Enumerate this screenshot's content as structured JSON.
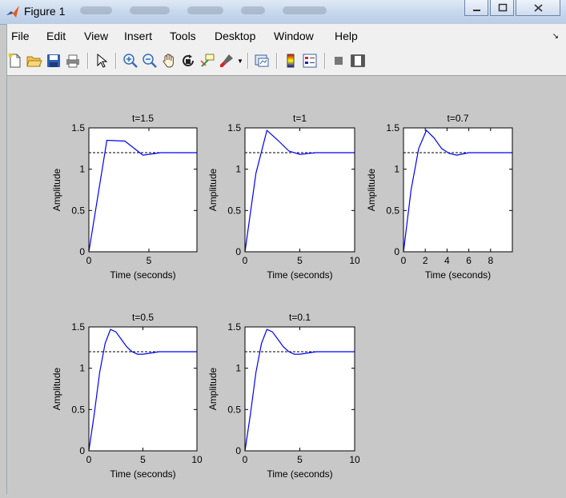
{
  "window": {
    "title": "Figure 1"
  },
  "menu": {
    "items": [
      "File",
      "Edit",
      "View",
      "Insert",
      "Tools",
      "Desktop",
      "Window",
      "Help"
    ]
  },
  "toolbar": {
    "icons": [
      "new-figure-icon",
      "open-file-icon",
      "save-icon",
      "print-icon",
      "pointer-icon",
      "zoom-in-icon",
      "zoom-out-icon",
      "pan-hand-icon",
      "rotate-3d-icon",
      "data-cursor-icon",
      "brush-icon",
      "link-plot-icon",
      "colorbar-icon",
      "legend-icon",
      "hide-plot-tools-icon",
      "show-plot-tools-icon"
    ]
  },
  "colors": {
    "step_line": "#0000ff",
    "final_value_line": "#000000",
    "axes_bg": "#ffffff",
    "figure_bg": "#c8c8c8"
  },
  "chart_data": [
    {
      "type": "line",
      "title": "t=1.5",
      "xlabel": "Time (seconds)",
      "ylabel": "Amplitude",
      "xlim": [
        0,
        9
      ],
      "ylim": [
        0,
        1.5
      ],
      "xticks": [
        0,
        5
      ],
      "yticks": [
        0,
        0.5,
        1,
        1.5
      ],
      "final_value": 1.2,
      "series": [
        {
          "x": [
            0,
            1.5,
            3.0,
            4.5,
            6.0,
            9.0
          ],
          "y": [
            0,
            1.35,
            1.34,
            1.17,
            1.2,
            1.2
          ]
        }
      ]
    },
    {
      "type": "line",
      "title": "t=1",
      "xlabel": "Time (seconds)",
      "ylabel": "Amplitude",
      "xlim": [
        0,
        10
      ],
      "ylim": [
        0,
        1.5
      ],
      "xticks": [
        0,
        5,
        10
      ],
      "yticks": [
        0,
        0.5,
        1,
        1.5
      ],
      "final_value": 1.2,
      "series": [
        {
          "x": [
            0,
            1.0,
            2.0,
            3.0,
            4.0,
            5.0,
            6.5,
            10.0
          ],
          "y": [
            0,
            0.95,
            1.47,
            1.35,
            1.22,
            1.18,
            1.2,
            1.2
          ]
        }
      ]
    },
    {
      "type": "line",
      "title": "t=0.7",
      "xlabel": "Time (seconds)",
      "ylabel": "Amplitude",
      "xlim": [
        0,
        10
      ],
      "ylim": [
        0,
        1.5
      ],
      "xticks": [
        0,
        2,
        4,
        6,
        8
      ],
      "yticks": [
        0,
        0.5,
        1,
        1.5
      ],
      "final_value": 1.2,
      "series": [
        {
          "x": [
            0,
            0.7,
            1.4,
            2.1,
            2.8,
            3.5,
            4.2,
            4.9,
            6.0,
            10.0
          ],
          "y": [
            0,
            0.75,
            1.25,
            1.47,
            1.38,
            1.25,
            1.19,
            1.17,
            1.2,
            1.2
          ]
        }
      ]
    },
    {
      "type": "line",
      "title": "t=0.5",
      "xlabel": "Time (seconds)",
      "ylabel": "Amplitude",
      "xlim": [
        0,
        10
      ],
      "ylim": [
        0,
        1.5
      ],
      "xticks": [
        0,
        5,
        10
      ],
      "yticks": [
        0,
        0.5,
        1,
        1.5
      ],
      "final_value": 1.2,
      "series": [
        {
          "x": [
            0,
            0.5,
            1.0,
            1.5,
            2.0,
            2.5,
            3.0,
            3.5,
            4.0,
            4.5,
            5.0,
            5.5,
            6.5,
            10.0
          ],
          "y": [
            0,
            0.45,
            0.95,
            1.3,
            1.47,
            1.44,
            1.35,
            1.26,
            1.2,
            1.17,
            1.17,
            1.18,
            1.2,
            1.2
          ]
        }
      ]
    },
    {
      "type": "line",
      "title": "t=0.1",
      "xlabel": "Time (seconds)",
      "ylabel": "Amplitude",
      "xlim": [
        0,
        10
      ],
      "ylim": [
        0,
        1.5
      ],
      "xticks": [
        0,
        5,
        10
      ],
      "yticks": [
        0,
        0.5,
        1,
        1.5
      ],
      "final_value": 1.2,
      "series": [
        {
          "x": [
            0,
            0.5,
            1.0,
            1.5,
            2.0,
            2.5,
            3.0,
            3.5,
            4.0,
            4.5,
            5.0,
            5.5,
            6.5,
            10.0
          ],
          "y": [
            0,
            0.45,
            0.95,
            1.3,
            1.47,
            1.44,
            1.35,
            1.26,
            1.2,
            1.17,
            1.17,
            1.18,
            1.2,
            1.2
          ]
        }
      ]
    }
  ]
}
